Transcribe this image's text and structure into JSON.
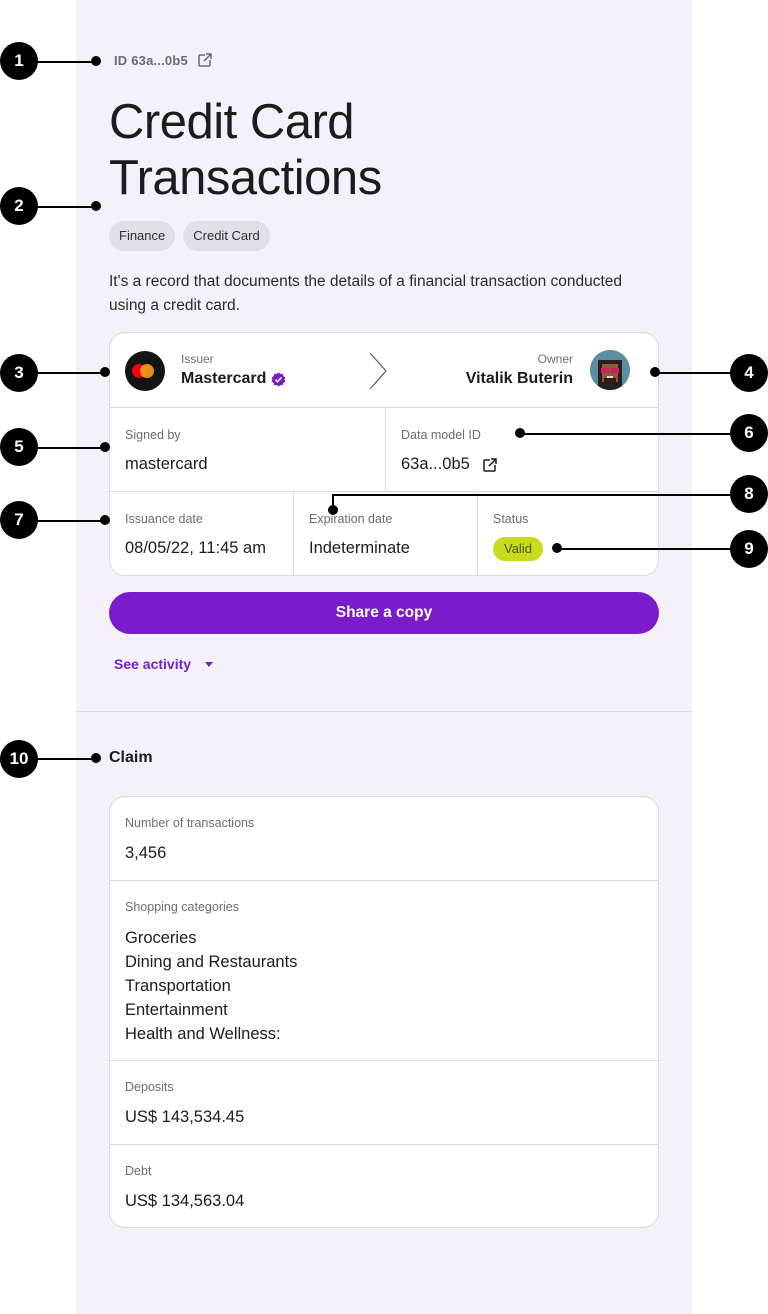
{
  "header": {
    "id_text": "ID 63a...0b5",
    "title": "Credit Card Transactions",
    "tags": [
      "Finance",
      "Credit Card"
    ],
    "description": "It's a record that documents the details of a financial transaction conducted using a credit card."
  },
  "credential": {
    "issuer_label": "Issuer",
    "issuer_name": "Mastercard",
    "owner_label": "Owner",
    "owner_name": "Vitalik Buterin",
    "signed_by_label": "Signed by",
    "signed_by_value": "mastercard",
    "data_model_label": "Data model ID",
    "data_model_value": "63a...0b5",
    "issuance_label": "Issuance date",
    "issuance_value": "08/05/22, 11:45 am",
    "expiration_label": "Expiration date",
    "expiration_value": "Indeterminate",
    "status_label": "Status",
    "status_value": "Valid",
    "status_color": "#c8dc1e"
  },
  "actions": {
    "share_label": "Share a copy",
    "activity_label": "See activity"
  },
  "claim": {
    "heading": "Claim",
    "transactions_label": "Number of transactions",
    "transactions_value": "3,456",
    "categories_label": "Shopping categories",
    "categories": [
      "Groceries",
      "Dining and Restaurants",
      "Transportation",
      "Entertainment",
      "Health and Wellness:"
    ],
    "deposits_label": "Deposits",
    "deposits_value": "US$ 143,534.45",
    "debt_label": "Debt",
    "debt_value": "US$ 134,563.04"
  },
  "annotations": [
    "1",
    "2",
    "3",
    "4",
    "5",
    "6",
    "7",
    "8",
    "9",
    "10"
  ],
  "colors": {
    "accent": "#7a1ccb",
    "panel_bg": "#f4f2f8",
    "border": "#dcd9e1"
  },
  "icons": {
    "external_link": "external-link-icon",
    "verified": "verified-badge-icon",
    "arrow": "chevron-right-icon",
    "caret": "caret-down-icon",
    "issuer_logo": "mastercard-logo-icon",
    "owner_avatar": "avatar"
  }
}
